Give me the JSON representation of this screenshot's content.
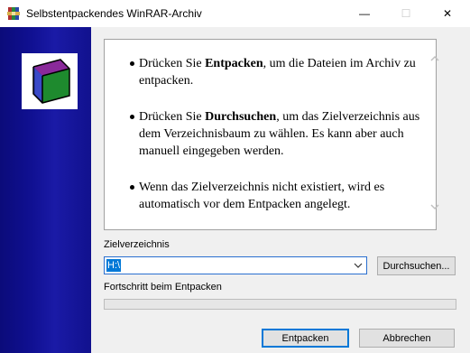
{
  "window": {
    "title": "Selbstentpackendes WinRAR-Archiv",
    "controls": {
      "minimize": "—",
      "maximize": "☐",
      "close": "✕"
    }
  },
  "instructions": {
    "bullets": [
      {
        "before": "Drücken Sie ",
        "bold": "Entpacken",
        "after": ", um die Dateien im Archiv zu entpacken."
      },
      {
        "before": "Drücken Sie ",
        "bold": "Durchsuchen",
        "after": ", um das Zielverzeichnis aus dem Verzeichnisbaum zu wählen. Es kann aber auch manuell eingegeben werden."
      },
      {
        "before": "",
        "bold": "",
        "after": "Wenn das Zielverzeichnis nicht existiert, wird es automatisch vor dem Entpacken angelegt."
      }
    ]
  },
  "destination": {
    "label": "Zielverzeichnis",
    "value": "H:\\",
    "browse_label": "Durchsuchen..."
  },
  "progress": {
    "label": "Fortschritt beim Entpacken",
    "value": 0
  },
  "buttons": {
    "extract": "Entpacken",
    "cancel": "Abbrechen"
  },
  "icons": {
    "app": "winrar-archive-icon",
    "banner": "winrar-box-icon"
  },
  "colors": {
    "banner": "#11118e",
    "accent": "#0078d7"
  }
}
